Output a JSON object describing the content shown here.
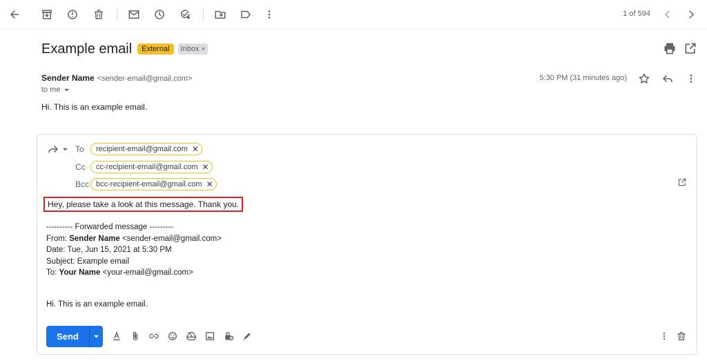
{
  "toolbar": {
    "pager_text": "1 of 594",
    "icons": [
      "back-arrow-icon",
      "archive-icon",
      "report-spam-icon",
      "delete-icon",
      "mark-unread-icon",
      "snooze-icon",
      "add-task-icon",
      "move-to-icon",
      "label-icon",
      "more-vert-icon",
      "chevron-left-icon",
      "chevron-right-icon"
    ]
  },
  "email": {
    "subject": "Example email",
    "tag_external": "External",
    "tag_inbox": "Inbox",
    "tag_inbox_remove": "×",
    "sender_name": "Sender Name",
    "sender_email": "<sender-email@gmail.com>",
    "to_me": "to me",
    "time": "5:30 PM (31 minutes ago)",
    "body": "Hi. This is an example email."
  },
  "compose": {
    "to_label": "To",
    "cc_label": "Cc",
    "bcc_label": "Bcc",
    "to_chip": "recipient-email@gmail.com",
    "cc_chip": "cc-recipient-email@gmail.com",
    "bcc_chip": "bcc-recipient-email@gmail.com",
    "message": "Hey, please take a look at this message. Thank you.",
    "forward": {
      "header": "---------- Forwarded message ---------",
      "from_label": "From: ",
      "from_name": "Sender Name",
      "from_email": " <sender-email@gmail.com>",
      "date": "Date: Tue, Jun 15, 2021 at 5:30 PM",
      "subject": "Subject: Example email",
      "to_label": "To: ",
      "to_name": "Your Name",
      "to_email": " <your-email@gmail.com>",
      "body": "Hi. This is an example email."
    },
    "send_label": "Send"
  },
  "colors": {
    "accent": "#1a73e8",
    "external_tag": "#f6bf26",
    "highlight": "#e02020"
  }
}
